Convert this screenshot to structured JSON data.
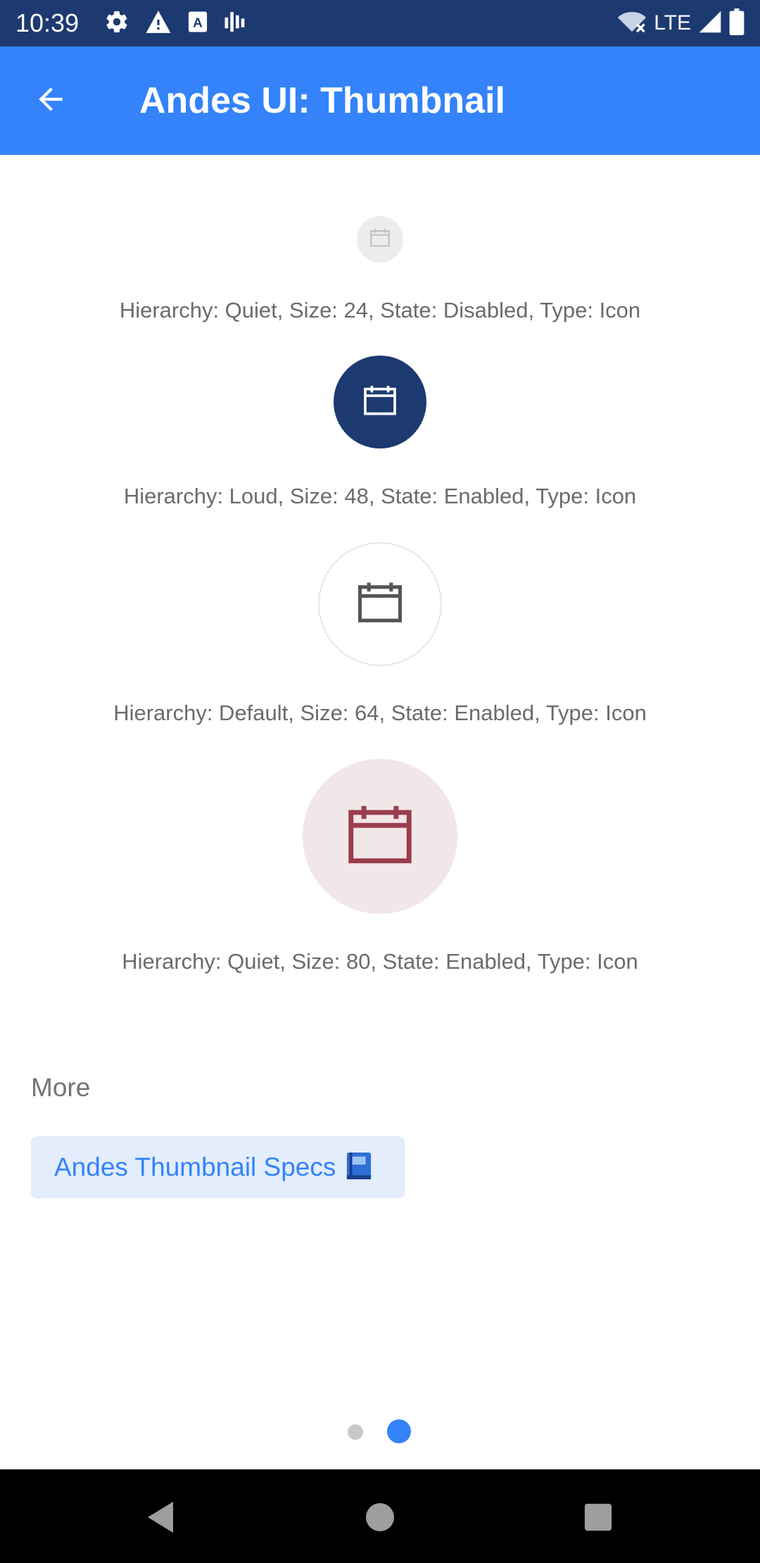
{
  "status_bar": {
    "time": "10:39",
    "network": "LTE",
    "left_icons": [
      "gear-icon",
      "warning-icon",
      "a-box-icon",
      "signal-bars-icon"
    ],
    "right_icons": [
      "wifi-off-icon",
      "cell-signal-icon",
      "battery-icon"
    ]
  },
  "app_bar": {
    "title": "Andes UI: Thumbnail",
    "back_icon": "arrow-left-icon",
    "color": "#3483fa"
  },
  "thumbnails": [
    {
      "caption": "Hierarchy: Quiet, Size: 24, State: Disabled, Type: Icon",
      "background": "#ececec",
      "icon_color": "#c2c2c2",
      "icon": "calendar-icon"
    },
    {
      "caption": "Hierarchy: Loud, Size: 48, State: Enabled, Type: Icon",
      "background": "#1c3a70",
      "icon_color": "#ffffff",
      "icon": "calendar-icon"
    },
    {
      "caption": "Hierarchy: Default, Size: 64, State: Enabled, Type: Icon",
      "background": "#ffffff",
      "icon_color": "#555555",
      "icon": "calendar-icon"
    },
    {
      "caption": "Hierarchy: Quiet, Size: 80, State: Enabled, Type: Icon",
      "background": "#f1e6e8",
      "icon_color": "#9b3d4d",
      "icon": "calendar-icon"
    }
  ],
  "more": {
    "label": "More",
    "link_label": "Andes Thumbnail Specs",
    "link_icon": "book-icon"
  },
  "pager": {
    "count": 2,
    "active_index": 1
  },
  "nav_bar": {
    "icons": [
      "back-triangle-icon",
      "home-circle-icon",
      "recents-square-icon"
    ]
  }
}
